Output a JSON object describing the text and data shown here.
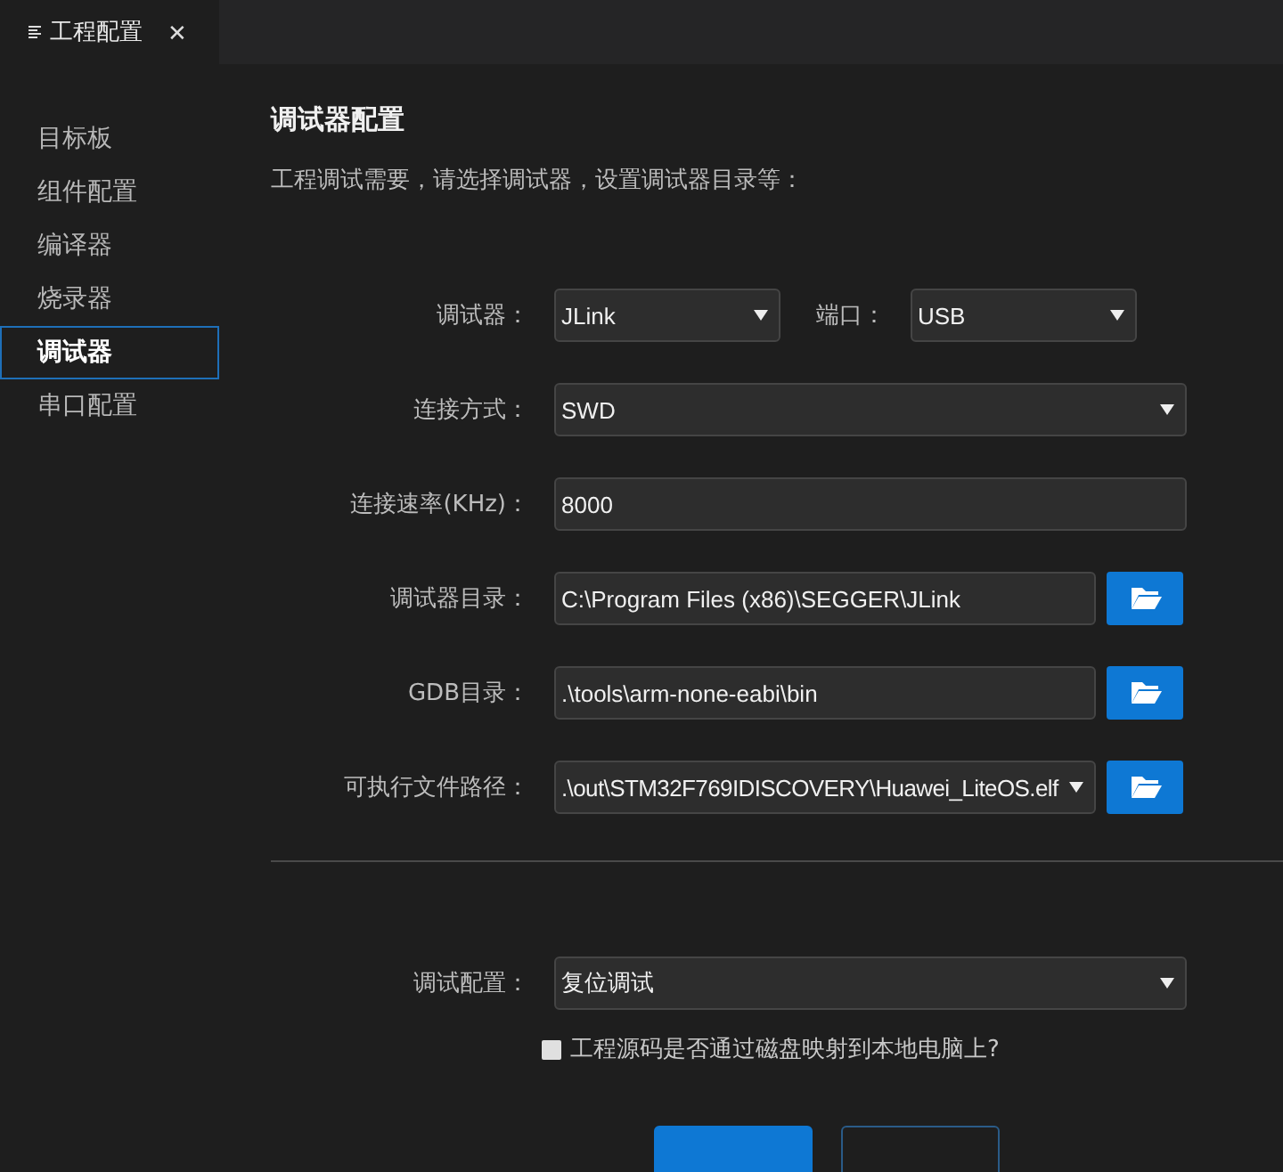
{
  "tab": {
    "title": "工程配置",
    "close": "✕"
  },
  "sidebar": {
    "items": [
      {
        "label": "目标板",
        "selected": false
      },
      {
        "label": "组件配置",
        "selected": false
      },
      {
        "label": "编译器",
        "selected": false
      },
      {
        "label": "烧录器",
        "selected": false
      },
      {
        "label": "调试器",
        "selected": true
      },
      {
        "label": "串口配置",
        "selected": false
      }
    ]
  },
  "heading": "调试器配置",
  "description": "工程调试需要，请选择调试器，设置调试器目录等：",
  "rows": [
    {
      "fields": [
        {
          "label": "调试器：",
          "kind": "short-select",
          "value": "JLink"
        },
        {
          "label": "端口：",
          "kind": "short-select",
          "value": "USB"
        }
      ]
    },
    {
      "fields": [
        {
          "label": "连接方式：",
          "kind": "select",
          "value": "SWD"
        }
      ]
    },
    {
      "fields": [
        {
          "label": "连接速率(KHz)：",
          "kind": "input",
          "value": "8000"
        }
      ]
    },
    {
      "fields": [
        {
          "label": "调试器目录：",
          "kind": "path",
          "value": "C:\\Program Files (x86)\\SEGGER\\JLink"
        }
      ]
    },
    {
      "fields": [
        {
          "label": "GDB目录：",
          "kind": "path",
          "value": ".\\tools\\arm-none-eabi\\bin"
        }
      ]
    },
    {
      "fields": [
        {
          "label": "可执行文件路径：",
          "kind": "path-select",
          "value": ".\\out\\STM32F769IDISCOVERY\\Huawei_LiteOS.elf"
        }
      ]
    }
  ],
  "debug_config": {
    "label": "调试配置：",
    "value": "复位调试"
  },
  "disk_mapping": {
    "label": "工程源码是否通过磁盘映射到本地电脑上?",
    "checked": false
  },
  "footer_buttons": [
    {
      "kind": "primary"
    },
    {
      "kind": "secondary"
    }
  ]
}
